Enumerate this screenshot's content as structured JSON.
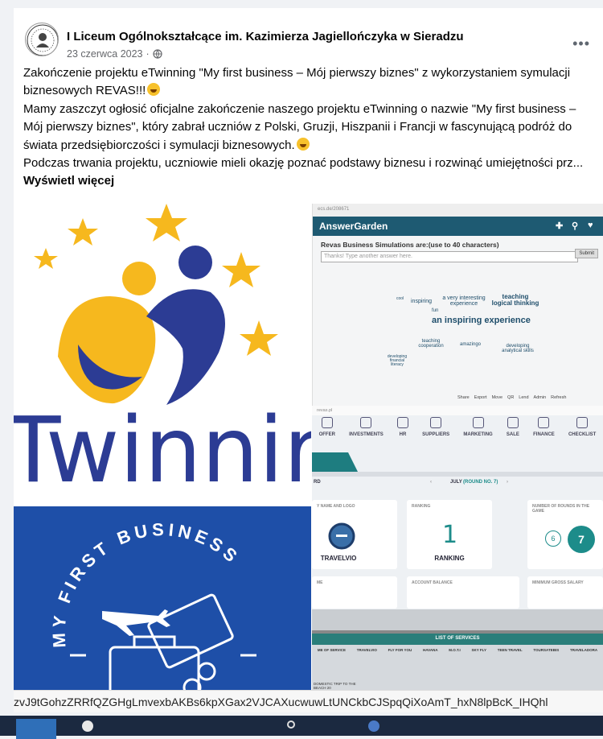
{
  "post": {
    "page_name": "I Liceum Ogólnokształcące im. Kazimierza Jagiellończyka w Sieradzu",
    "date": "23 czerwca 2023",
    "separator": "·",
    "more_label": "•••",
    "paragraphs": [
      "Zakończenie projektu eTwinning \"My first business – Mój pierwszy biznes\" z wykorzystaniem symulacji biznesowych REVAS!!!",
      "Mamy zaszczyt ogłosić oficjalne zakończenie naszego projektu eTwinning o nazwie \"My first business – Mój pierwszy biznes\", który zabrał uczniów z Polski, Gruzji, Hiszpanii i Francji w fascynującą podróż do świata przedsiębiorczości i symulacji biznesowych.",
      "Podczas trwania projektu, uczniowie mieli okazję poznać podstawy biznesu i rozwinąć umiejętności prz..."
    ],
    "see_more": "Wyświetl więcej"
  },
  "images": {
    "etwinning_text": "Twinnir",
    "business_text": "MY FIRST BUSINESS",
    "answergarden": {
      "url": "ecs.de/208671",
      "brand": "AnswerGarden",
      "title": "Revas Business Simulations are:(use to 40 characters)",
      "placeholder": "Thanks! Type another answer here.",
      "submit": "Submit",
      "words": [
        {
          "t": "an inspiring experience",
          "s": 11
        },
        {
          "t": "teaching logical thinking",
          "s": 8
        },
        {
          "t": "a very interesting experience",
          "s": 7
        },
        {
          "t": "inspiring",
          "s": 7
        },
        {
          "t": "teaching cooperation",
          "s": 6
        },
        {
          "t": "amazingo",
          "s": 6
        },
        {
          "t": "developing analytical skills",
          "s": 6
        },
        {
          "t": "fun",
          "s": 6
        },
        {
          "t": "developing financial literacy",
          "s": 5
        },
        {
          "t": "cool",
          "s": 5
        }
      ],
      "bottom_buttons": [
        "Share",
        "Export",
        "Move",
        "QR",
        "Lend",
        "Admin",
        "Refresh"
      ]
    },
    "revas": {
      "url": "revas.pl",
      "nav": [
        "OFFER",
        "INVESTMENTS",
        "HR",
        "SUPPLIERS",
        "MARKETING",
        "SALE",
        "FINANCE",
        "CHECKLIST"
      ],
      "round_left": "RD",
      "round_label": "JULY",
      "round_note": "(ROUND NO. 7)",
      "tiles": [
        {
          "h": "Y NAME AND LOGO",
          "v": "TRAVELVIO"
        },
        {
          "h": "RANKING",
          "v": "RANKING",
          "big": "1"
        },
        {
          "h": "NUMBER OF ROUNDS IN THE GAME",
          "v": "",
          "a": "6",
          "b": "7"
        }
      ],
      "lower_tiles": [
        "ME",
        "ACCOUNT BALANCE",
        "MINIMUM GROSS SALARY"
      ]
    },
    "services": {
      "title": "LIST OF SERVICES",
      "cols": [
        "ME OF SERVICE",
        "TRAVELVIO",
        "FLY FOR YOU",
        "HAVANA",
        "M.O.T.I",
        "SKY FLY",
        "TEEN TRAVEL",
        "TOURSATEBIS",
        "TRAVELADORA"
      ],
      "row": "DOMESTIC TRIP TO THE BEACH 20"
    }
  },
  "browser": {
    "url_fragment": "zvJ9tGohzZRRfQZGHgLmvexbAKBs6kpXGax2VJCAXucwuwLtUNCkbCJSpqQiXoAmT_hxN8lpBcK_IHQhl"
  },
  "colors": {
    "etwinning_blue": "#2c3c94",
    "etwinning_yellow": "#f6b81e",
    "business_bg": "#1e4fa8",
    "teal": "#1e5a72"
  }
}
